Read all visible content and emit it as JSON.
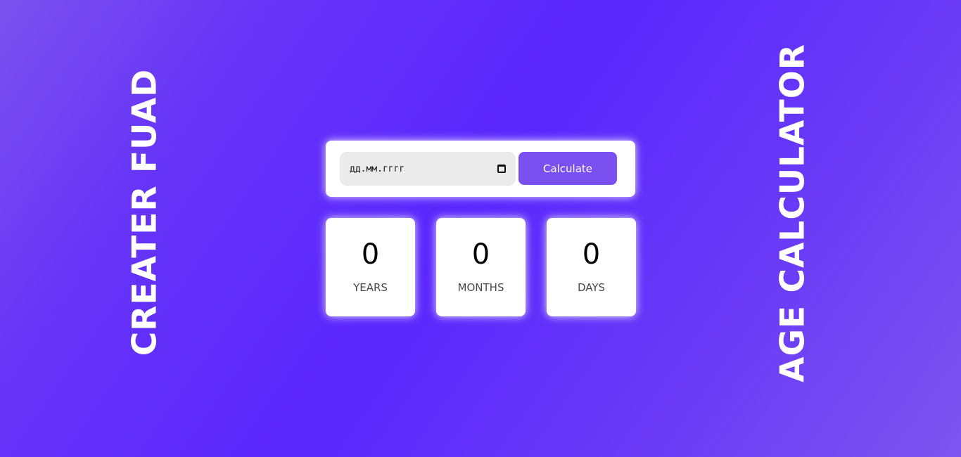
{
  "side_titles": {
    "left": "CREATER FUAD",
    "right": "AGE CALCULATOR"
  },
  "form": {
    "date_placeholder": "дд.мм.гггг",
    "calendar_icon": "calendar-icon",
    "button_label": "Calculate"
  },
  "results": {
    "years": {
      "value": "0",
      "label": "YEARS"
    },
    "months": {
      "value": "0",
      "label": "MONTHS"
    },
    "days": {
      "value": "0",
      "label": "DAYS"
    }
  },
  "colors": {
    "background": "#5a27fd",
    "button": "#7b50f0",
    "card": "#ffffff",
    "input_bg": "#ebebeb"
  }
}
